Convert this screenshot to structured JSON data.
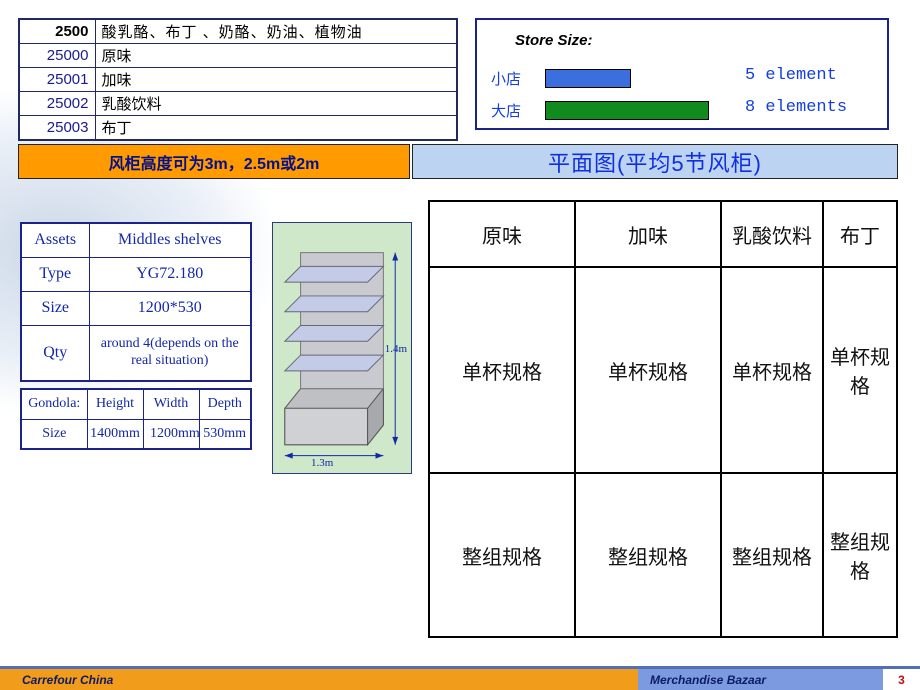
{
  "categories": {
    "header": {
      "code": "2500",
      "name": "酸乳酪、布丁 、奶酪、奶油、植物油"
    },
    "rows": [
      {
        "code": "25000",
        "name": "原味"
      },
      {
        "code": "25001",
        "name": "加味"
      },
      {
        "code": "25002",
        "name": "乳酸饮料"
      },
      {
        "code": "25003",
        "name": "布丁"
      }
    ]
  },
  "store_size": {
    "title": "Store Size:",
    "small_label": "小店",
    "large_label": "大店",
    "small_count": "5 element",
    "large_count": "8 elements"
  },
  "banners": {
    "orange": "风柜高度可为3m，2.5m或2m",
    "blue": "平面图(平均5节风柜)"
  },
  "assets": {
    "rows": {
      "assets_label": "Assets",
      "assets_value": "Middles shelves",
      "type_label": "Type",
      "type_value": "YG72.180",
      "size_label": "Size",
      "size_value": "1200*530",
      "qty_label": "Qty",
      "qty_value": "around 4(depends on the real situation)"
    },
    "gondola_header": {
      "c0": "Gondola:",
      "c1": "Height",
      "c2": "Width",
      "c3": "Depth"
    },
    "gondola_values": {
      "c0": "Size",
      "c1": "1400mm",
      "overlay": "1200mm  530mm"
    }
  },
  "shelf_diagram": {
    "height_label": "1.4m",
    "width_label": "1.3m"
  },
  "planogram": {
    "headers": [
      "原味",
      "加味",
      "乳酸饮料",
      "布丁"
    ],
    "row1": [
      "单杯规格",
      "单杯规格",
      "单杯规格",
      "单杯规格"
    ],
    "row2": [
      "整组规格",
      "整组规格",
      "整组规格",
      "整组规格"
    ]
  },
  "footer": {
    "left": "Carrefour China",
    "mid": "Merchandise Bazaar",
    "page": "3"
  }
}
